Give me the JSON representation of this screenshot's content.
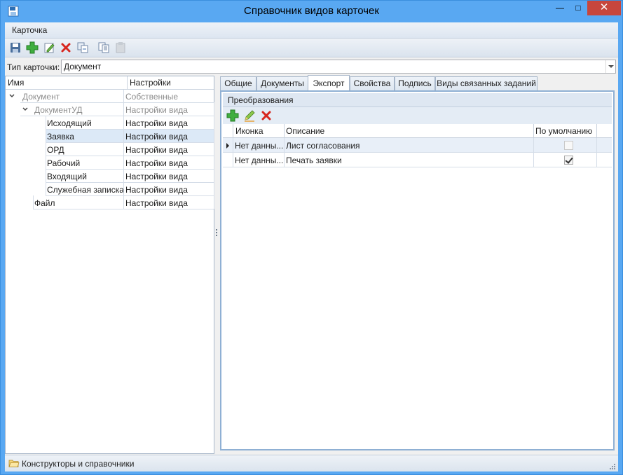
{
  "window": {
    "title": "Справочник видов карточек",
    "close_glyph": "✕",
    "minimize_glyph": "—",
    "maximize_glyph": "□"
  },
  "menu": {
    "items": [
      {
        "label": "Карточка"
      }
    ]
  },
  "toolbar": {
    "buttons": [
      {
        "name": "save",
        "icon": "save-icon"
      },
      {
        "name": "add",
        "icon": "add-icon"
      },
      {
        "name": "edit",
        "icon": "edit-icon"
      },
      {
        "name": "delete",
        "icon": "delete-icon"
      },
      {
        "name": "copy-link",
        "icon": "copy-link-icon"
      },
      {
        "name": "copy",
        "icon": "copy-icon"
      },
      {
        "name": "paste",
        "icon": "paste-icon",
        "disabled": true
      }
    ]
  },
  "card_type": {
    "label": "Тип карточки:",
    "value": "Документ"
  },
  "tree": {
    "columns": {
      "name": "Имя",
      "settings": "Настройки"
    },
    "rows": [
      {
        "name": "Документ",
        "settings": "Собственные",
        "muted": true,
        "expandable": true
      },
      {
        "name": "ДокументУД",
        "settings": "Настройки вида",
        "muted": true,
        "expandable": true
      },
      {
        "name": "Исходящий",
        "settings": "Настройки вида"
      },
      {
        "name": "Заявка",
        "settings": "Настройки вида",
        "selected": true
      },
      {
        "name": "ОРД",
        "settings": "Настройки вида"
      },
      {
        "name": "Рабочий",
        "settings": "Настройки вида"
      },
      {
        "name": "Входящий",
        "settings": "Настройки вида"
      },
      {
        "name": "Служебная записка",
        "settings": "Настройки вида"
      },
      {
        "name": "Файл",
        "settings": "Настройки вида"
      }
    ]
  },
  "tabs": [
    {
      "label": "Общие"
    },
    {
      "label": "Документы"
    },
    {
      "label": "Экспорт",
      "active": true
    },
    {
      "label": "Свойства"
    },
    {
      "label": "Подпись"
    },
    {
      "label": "Виды связанных заданий"
    }
  ],
  "export": {
    "group_title": "Преобразования",
    "toolbar": [
      {
        "name": "add",
        "icon": "add-icon"
      },
      {
        "name": "edit",
        "icon": "pencil-icon"
      },
      {
        "name": "delete",
        "icon": "delete-icon"
      }
    ],
    "columns": {
      "icon": "Иконка",
      "description": "Описание",
      "default": "По умолчанию"
    },
    "rows": [
      {
        "icon": "Нет данны...",
        "description": "Лист согласования",
        "default": false,
        "current": true
      },
      {
        "icon": "Нет данны...",
        "description": "Печать заявки",
        "default": true
      }
    ]
  },
  "status": {
    "text": "Конструкторы и справочники"
  },
  "colors": {
    "accent": "#59a8f2",
    "close": "#c7463c",
    "selection": "#e0ecf9"
  }
}
